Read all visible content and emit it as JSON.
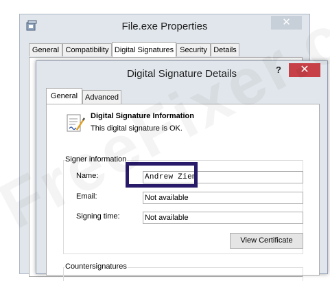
{
  "outer_window": {
    "title": "File.exe Properties",
    "close_glyph": "✕",
    "tabs": [
      "General",
      "Compatibility",
      "Digital Signatures",
      "Security",
      "Details"
    ],
    "active_tab": "Digital Signatures"
  },
  "dialog": {
    "title": "Digital Signature Details",
    "help_glyph": "?",
    "close_glyph": "✕",
    "tabs": [
      "General",
      "Advanced"
    ],
    "active_tab": "General",
    "info_title": "Digital Signature Information",
    "info_status": "This digital signature is OK.",
    "signer_group_label": "Signer information",
    "fields": {
      "name_label": "Name:",
      "name_value": "Andrew Ziem",
      "email_label": "Email:",
      "email_value": "Not available",
      "signing_time_label": "Signing time:",
      "signing_time_value": "Not available"
    },
    "view_certificate_label": "View Certificate",
    "countersignatures_label": "Countersignatures"
  },
  "watermark": "FreeFixer.com",
  "colors": {
    "highlight_border": "#291a6a",
    "dialog_close": "#c74048"
  }
}
